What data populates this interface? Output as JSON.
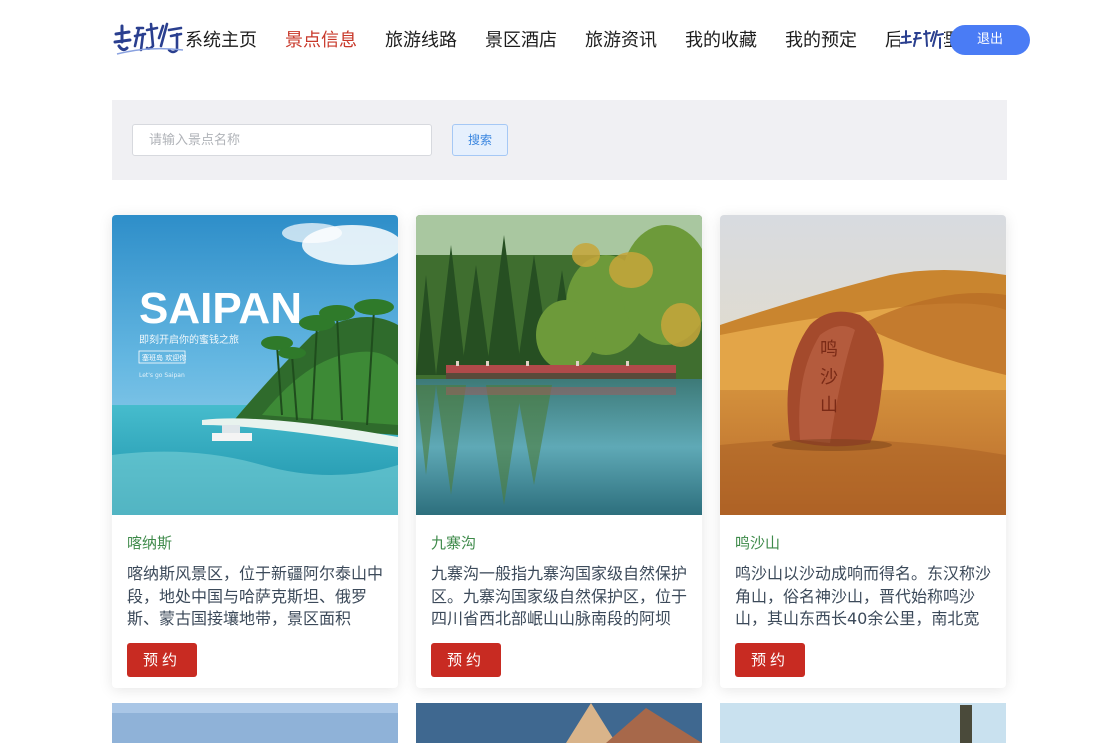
{
  "header": {
    "nav": [
      {
        "label": "系统主页",
        "active": false
      },
      {
        "label": "景点信息",
        "active": true
      },
      {
        "label": "旅游线路",
        "active": false
      },
      {
        "label": "景区酒店",
        "active": false
      },
      {
        "label": "旅游资讯",
        "active": false
      },
      {
        "label": "我的收藏",
        "active": false
      },
      {
        "label": "我的预定",
        "active": false
      },
      {
        "label": "后台管理",
        "active": false
      }
    ],
    "logout_label": "退出",
    "accent_color": "#c8382a",
    "logo_icon": "brush-calligraphy-logo-icon"
  },
  "search": {
    "placeholder": "请输入景点名称",
    "value": "",
    "button_label": "搜索"
  },
  "cards": [
    {
      "title": "喀纳斯",
      "desc": "喀纳斯风景区，位于新疆阿尔泰山中段，地处中国与哈萨克斯坦、俄罗斯、蒙古国接壤地带，景区面积",
      "book_label": "预约",
      "image_text": {
        "big": "SAIPAN",
        "sub": "即刻开启你的蜜钱之旅",
        "tag": "塞班岛 欢迎你",
        "small": "Let's go Saipan"
      }
    },
    {
      "title": "九寨沟",
      "desc": "九寨沟一般指九寨沟国家级自然保护区。九寨沟国家级自然保护区，位于四川省西北部岷山山脉南段的阿坝",
      "book_label": "预约",
      "image_text": {}
    },
    {
      "title": "鸣沙山",
      "desc": "鸣沙山以沙动成响而得名。东汉称沙角山，俗名神沙山，晋代始称鸣沙山，其山东西长40余公里，南北宽",
      "book_label": "预约",
      "image_text": {
        "stone": "鸣沙山"
      }
    }
  ]
}
